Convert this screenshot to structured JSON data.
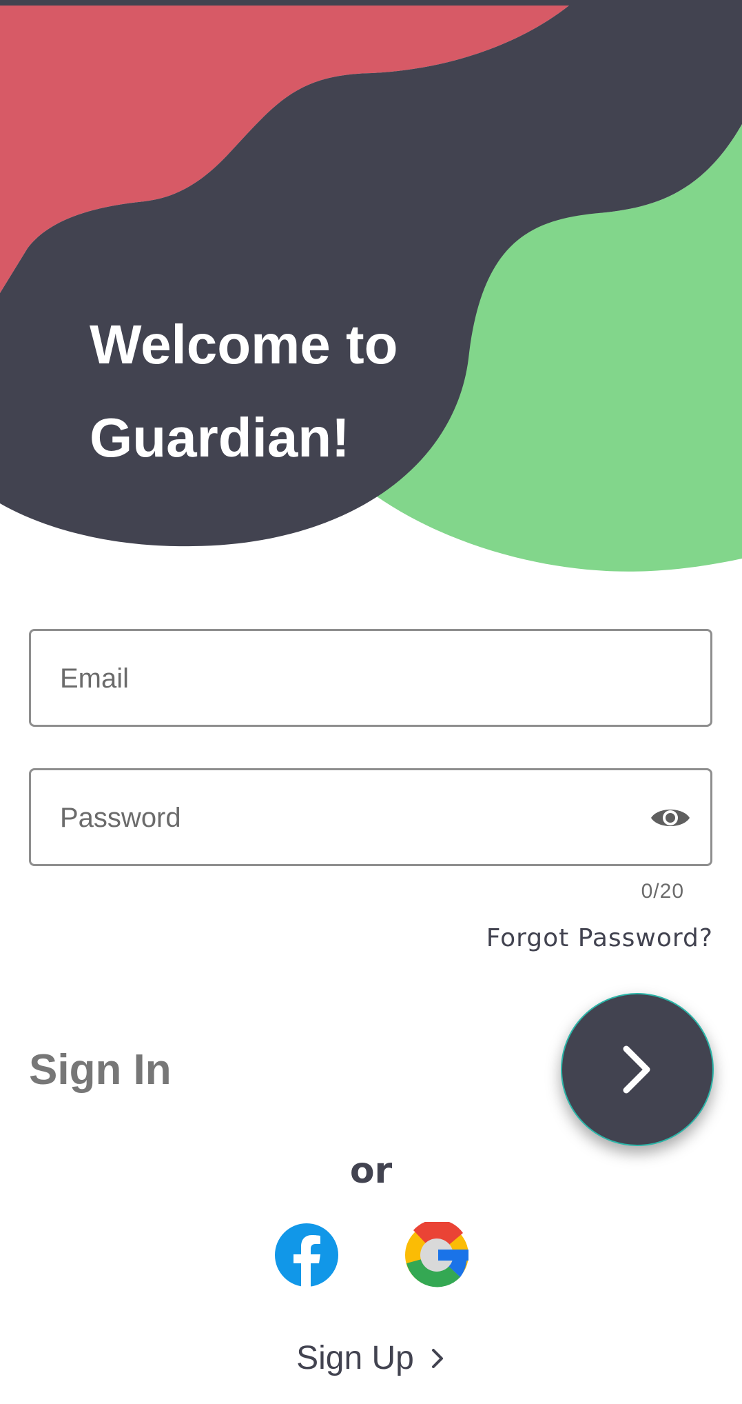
{
  "colors": {
    "dark": "#424350",
    "red": "#d75a66",
    "green": "#82d68b",
    "accent": "#2bb5a8"
  },
  "hero": {
    "title_line1": "Welcome to",
    "title_line2": "Guardian!"
  },
  "form": {
    "email_placeholder": "Email",
    "password_placeholder": "Password",
    "password_counter": "0/20",
    "forgot_password": "Forgot Password?"
  },
  "sign_in": {
    "label": "Sign In",
    "submit_icon": "chevron-right-icon"
  },
  "social": {
    "divider": "or",
    "providers": [
      "facebook-icon",
      "google-icon"
    ]
  },
  "sign_up": {
    "label": "Sign Up",
    "icon": "chevron-right-icon"
  }
}
